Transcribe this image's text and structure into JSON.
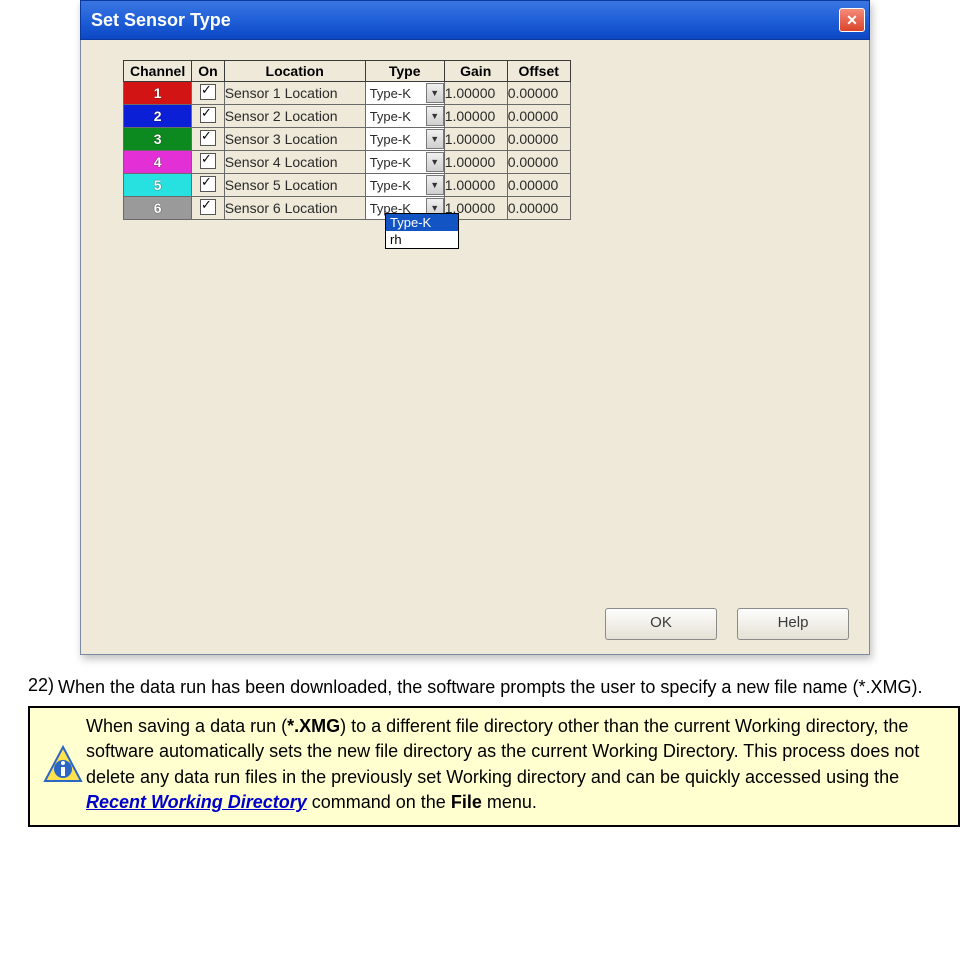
{
  "dialog": {
    "title": "Set Sensor Type",
    "headers": [
      "Channel",
      "On",
      "Location",
      "Type",
      "Gain",
      "Offset"
    ],
    "rows": [
      {
        "ch": "1",
        "color": "#d21414",
        "location": "Sensor 1 Location",
        "type": "Type-K",
        "gain": "1.00000",
        "offset": "0.00000"
      },
      {
        "ch": "2",
        "color": "#0b1fd6",
        "location": "Sensor 2 Location",
        "type": "Type-K",
        "gain": "1.00000",
        "offset": "0.00000"
      },
      {
        "ch": "3",
        "color": "#0c8a1f",
        "location": "Sensor 3 Location",
        "type": "Type-K",
        "gain": "1.00000",
        "offset": "0.00000"
      },
      {
        "ch": "4",
        "color": "#e22fd6",
        "location": "Sensor 4 Location",
        "type": "Type-K",
        "gain": "1.00000",
        "offset": "0.00000"
      },
      {
        "ch": "5",
        "color": "#27e0e0",
        "location": "Sensor 5 Location",
        "type": "Type-K",
        "gain": "1.00000",
        "offset": "0.00000"
      },
      {
        "ch": "6",
        "color": "#9a9a9a",
        "location": "Sensor 6 Location",
        "type": "Type-K",
        "gain": "1.00000",
        "offset": "0.00000"
      }
    ],
    "dropdown": {
      "options": [
        "Type-K",
        "rh"
      ],
      "selected": "Type-K"
    },
    "ok_label": "OK",
    "help_label": "Help"
  },
  "step": {
    "number": "22)",
    "text_a": "When the data run has been downloaded, the software prompts the user to specify a new file name (*.XMG)."
  },
  "note": {
    "t1": "When saving a data run (",
    "ext": "*.XMG",
    "t2": ") to a different file directory other than the current Working directory, the software automatically sets the new file directory as the current Working Directory. This process does not delete any data run files in the previously set Working directory and can be quickly accessed using the ",
    "link": "Recent Working Directory",
    "t3": " command on the ",
    "menu": "File",
    "t4": " menu."
  }
}
